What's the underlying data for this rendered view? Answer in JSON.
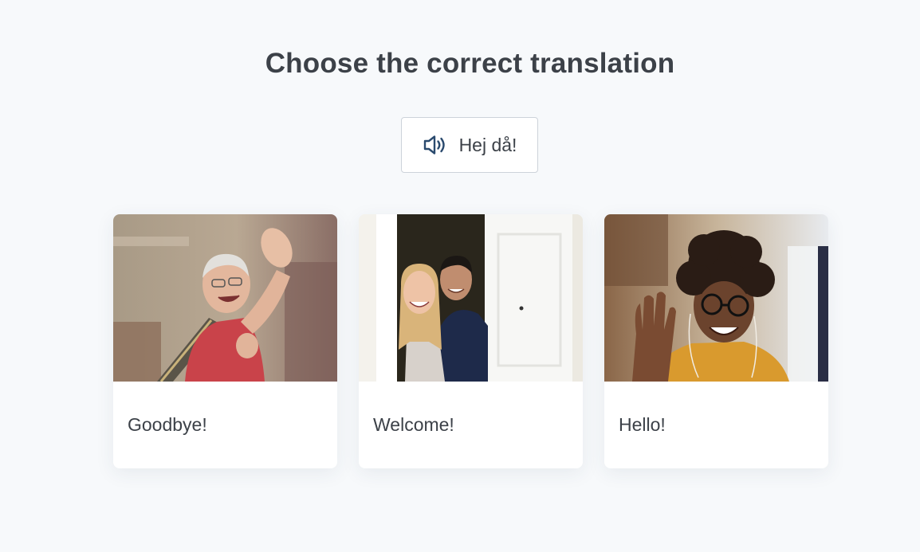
{
  "prompt": {
    "title": "Choose the correct translation"
  },
  "audio": {
    "phrase": "Hej då!",
    "icon": "speaker-icon",
    "icon_color": "#2a4a6e"
  },
  "options": [
    {
      "label": "Goodbye!",
      "image": "elderly woman waving goodbye with a bag"
    },
    {
      "label": "Welcome!",
      "image": "couple smiling at an open white door"
    },
    {
      "label": "Hello!",
      "image": "smiling man with glasses waving hello"
    }
  ],
  "colors": {
    "background": "#f7f9fb",
    "text": "#3c4148",
    "card": "#ffffff",
    "button_border": "#cdd3da"
  }
}
